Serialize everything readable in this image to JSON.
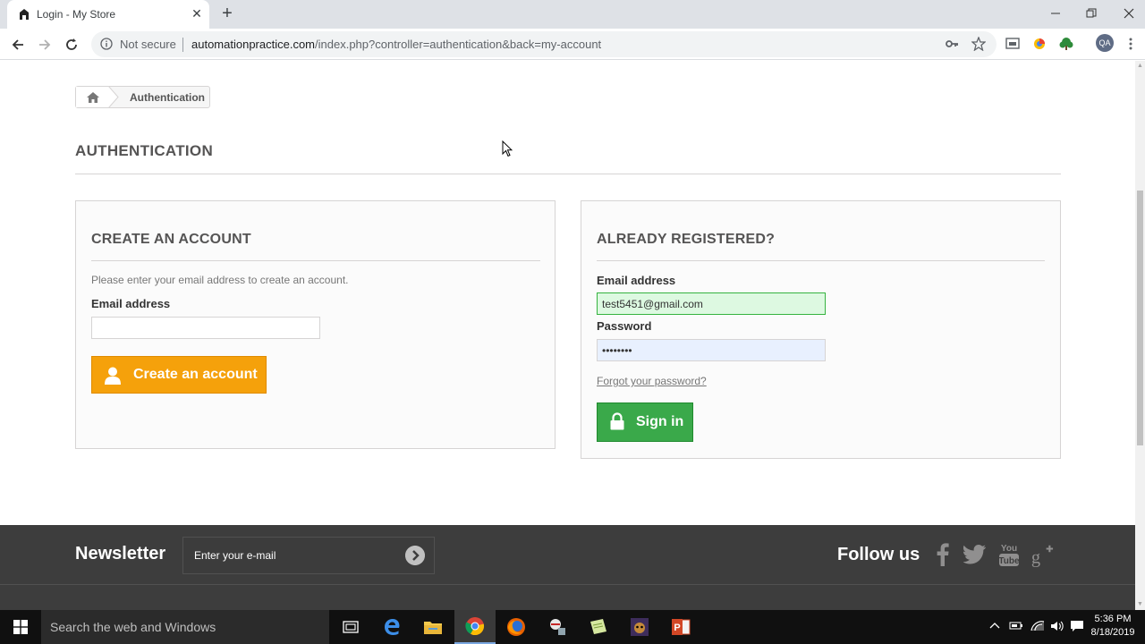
{
  "browser": {
    "tab_title": "Login - My Store",
    "tab_close": "✕",
    "new_tab": "+",
    "security_label": "Not secure",
    "url_host": "automationpractice.com",
    "url_path": "/index.php?controller=authentication&back=my-account",
    "profile_initials": "QA"
  },
  "breadcrumb": {
    "current": "Authentication"
  },
  "page": {
    "heading": "AUTHENTICATION"
  },
  "create_account": {
    "title": "CREATE AN ACCOUNT",
    "instructions": "Please enter your email address to create an account.",
    "email_label": "Email address",
    "email_value": "",
    "button_label": "Create an account"
  },
  "sign_in": {
    "title": "ALREADY REGISTERED?",
    "email_label": "Email address",
    "email_value": "test5451@gmail.com",
    "password_label": "Password",
    "password_value": "••••••••",
    "forgot_label": "Forgot your password?",
    "button_label": "Sign in"
  },
  "footer": {
    "newsletter_title": "Newsletter",
    "newsletter_placeholder": "Enter your e-mail",
    "follow_title": "Follow us"
  },
  "taskbar": {
    "search_placeholder": "Search the web and Windows",
    "time": "5:36 PM",
    "date": "8/18/2019"
  },
  "colors": {
    "create_button": "#f5a10b",
    "signin_button": "#3aa94a",
    "footer_bg": "#3d3d3d",
    "valid_field": "#ddf9e1"
  }
}
